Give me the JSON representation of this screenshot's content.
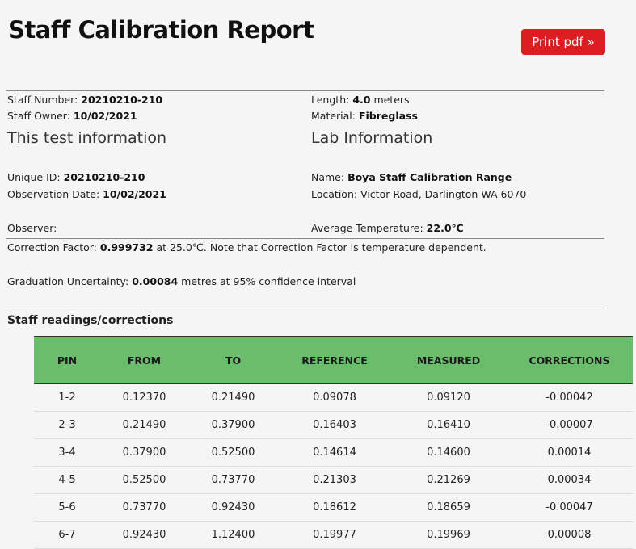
{
  "header": {
    "title": "Staff Calibration Report",
    "print_label": "Print pdf »"
  },
  "staff": {
    "number_label": "Staff Number: ",
    "number": "20210210-210",
    "owner_label": "Staff Owner: ",
    "owner": "10/02/2021",
    "length_label": "Length: ",
    "length": "4.0",
    "length_unit": " meters",
    "material_label": "Material: ",
    "material": "Fibreglass"
  },
  "test": {
    "heading": "This test information",
    "unique_id_label": "Unique ID: ",
    "unique_id": "20210210-210",
    "obs_date_label": "Observation Date: ",
    "obs_date": "10/02/2021",
    "observer_label": "Observer:"
  },
  "lab": {
    "heading": "Lab Information",
    "name_label": "Name: ",
    "name": "Boya Staff Calibration Range",
    "location_label": "Location: ",
    "location": "Victor Road, Darlington WA 6070",
    "avg_temp_label": "Average Temperature: ",
    "avg_temp": "22.0℃"
  },
  "correction": {
    "label": "Correction Factor: ",
    "value": "0.999732",
    "suffix": " at 25.0℃. Note that Correction Factor is temperature dependent."
  },
  "uncertainty": {
    "label": "Graduation Uncertainty: ",
    "value": "0.00084",
    "suffix": " metres at 95% confidence interval"
  },
  "readings": {
    "heading": "Staff readings/corrections",
    "columns": [
      "PIN",
      "FROM",
      "TO",
      "REFERENCE",
      "MEASURED",
      "CORRECTIONS"
    ],
    "rows": [
      [
        "1-2",
        "0.12370",
        "0.21490",
        "0.09078",
        "0.09120",
        "-0.00042"
      ],
      [
        "2-3",
        "0.21490",
        "0.37900",
        "0.16403",
        "0.16410",
        "-0.00007"
      ],
      [
        "3-4",
        "0.37900",
        "0.52500",
        "0.14614",
        "0.14600",
        "0.00014"
      ],
      [
        "4-5",
        "0.52500",
        "0.73770",
        "0.21303",
        "0.21269",
        "0.00034"
      ],
      [
        "5-6",
        "0.73770",
        "0.92430",
        "0.18612",
        "0.18659",
        "-0.00047"
      ],
      [
        "6-7",
        "0.92430",
        "1.12400",
        "0.19977",
        "0.19969",
        "0.00008"
      ]
    ]
  }
}
